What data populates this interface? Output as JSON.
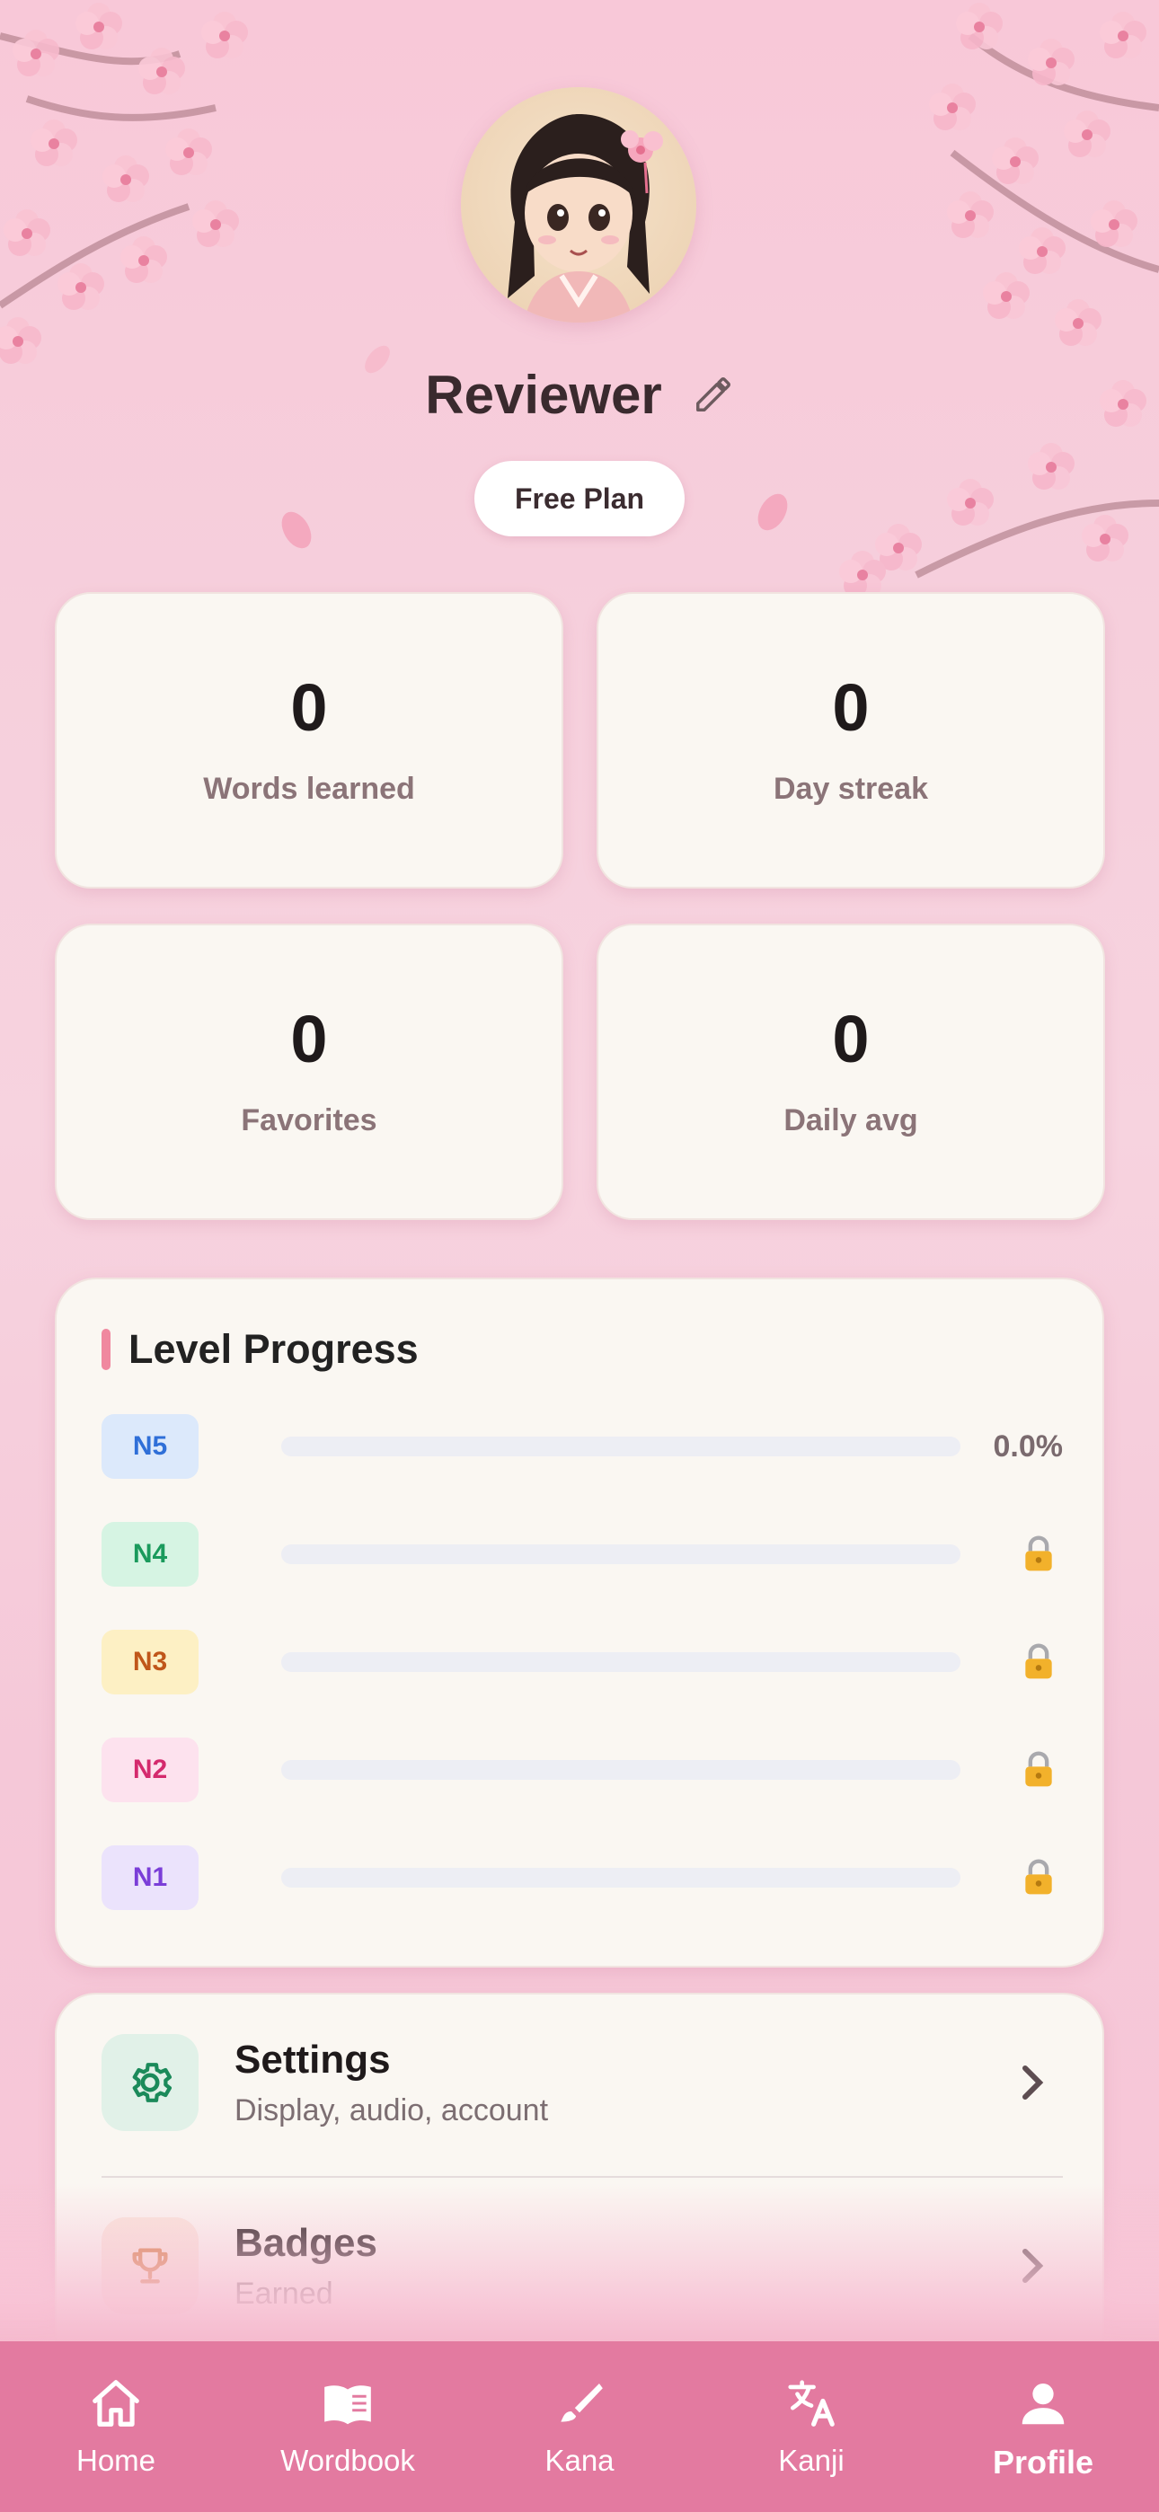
{
  "profile": {
    "name": "Reviewer",
    "plan": "Free Plan"
  },
  "stats": [
    {
      "value": "0",
      "label": "Words learned"
    },
    {
      "value": "0",
      "label": "Day streak"
    },
    {
      "value": "0",
      "label": "Favorites"
    },
    {
      "value": "0",
      "label": "Daily avg"
    }
  ],
  "level_progress": {
    "title": "Level Progress",
    "levels": [
      {
        "code": "N5",
        "progress": 0.0,
        "status": "0.0%",
        "locked": false,
        "color": "#2f6fd8",
        "bg": "#dce9fb"
      },
      {
        "code": "N4",
        "progress": 0.0,
        "locked": true,
        "color": "#1a9a5c",
        "bg": "#d6f4e3"
      },
      {
        "code": "N3",
        "progress": 0.0,
        "locked": true,
        "color": "#c0561a",
        "bg": "#fdf0c4"
      },
      {
        "code": "N2",
        "progress": 0.0,
        "locked": true,
        "color": "#d42a6d",
        "bg": "#fde2ee"
      },
      {
        "code": "N1",
        "progress": 0.0,
        "locked": true,
        "color": "#7a3ed8",
        "bg": "#ebe3fc"
      }
    ]
  },
  "menu": [
    {
      "title": "Settings",
      "subtitle": "Display, audio, account",
      "icon": "gear-icon",
      "icon_color": "#1b8a5a",
      "icon_bg": "#e1f1e8"
    },
    {
      "title": "Badges",
      "subtitle": "Earned",
      "icon": "trophy-icon",
      "icon_color": "#d37a3e",
      "icon_bg": "#f9e6dc"
    }
  ],
  "tabs": [
    {
      "label": "Home",
      "icon": "home-icon",
      "active": false
    },
    {
      "label": "Wordbook",
      "icon": "book-icon",
      "active": false
    },
    {
      "label": "Kana",
      "icon": "brush-icon",
      "active": false
    },
    {
      "label": "Kanji",
      "icon": "translate-icon",
      "active": false
    },
    {
      "label": "Profile",
      "icon": "person-icon",
      "active": true
    }
  ],
  "colors": {
    "accent": "#e37aa0",
    "card_bg": "#faf7f2",
    "section_bar": "#f0889f"
  }
}
